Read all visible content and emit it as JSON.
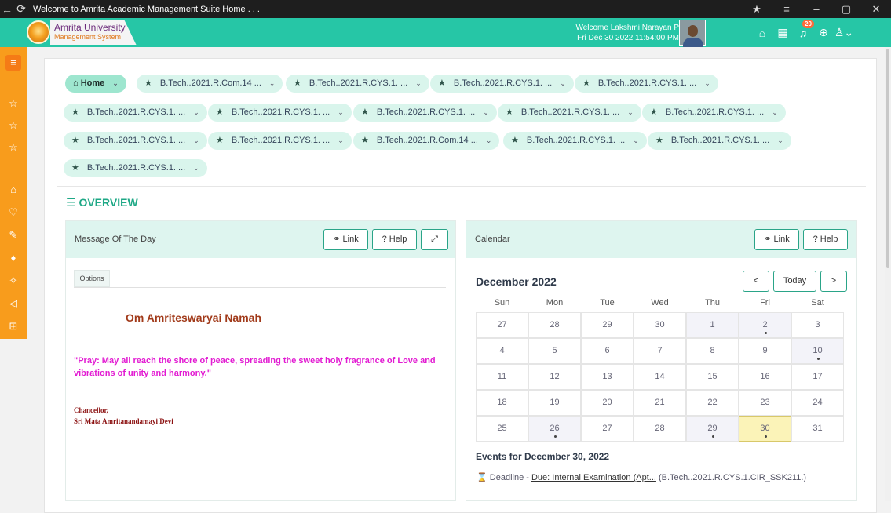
{
  "window": {
    "title": "Welcome to Amrita Academic Management Suite Home . . .",
    "back_icon": "←",
    "refresh_icon": "⟳",
    "pin_icon": "★",
    "menu_icon": "≡",
    "min_icon": "–",
    "max_icon": "▢",
    "close_icon": "✕"
  },
  "header": {
    "brand_line1": "Amrita University",
    "brand_line2": "Management System",
    "welcome": "Welcome Lakshmi Narayan P",
    "datetime": "Fri Dec 30 2022 11:54:00 PM",
    "notification_count": "20",
    "icons": {
      "home": "⌂",
      "grid": "▦",
      "bell": "♫",
      "globe": "⊕",
      "user": "♙⌄"
    }
  },
  "sidebar": {
    "items": [
      "≡",
      "☆",
      "☆",
      "☆",
      "⌂",
      "♡",
      "✎",
      "♦",
      "✧",
      "◁",
      "⊞"
    ]
  },
  "shortcuts": {
    "home_label": "Home",
    "items": [
      "B.Tech..2021.R.Com.14 ...",
      "B.Tech..2021.R.CYS.1. ...",
      "B.Tech..2021.R.CYS.1. ...",
      "B.Tech..2021.R.CYS.1. ...",
      "B.Tech..2021.R.CYS.1. ...",
      "B.Tech..2021.R.CYS.1. ...",
      "B.Tech..2021.R.CYS.1. ...",
      "B.Tech..2021.R.CYS.1. ...",
      "B.Tech..2021.R.CYS.1. ...",
      "B.Tech..2021.R.CYS.1. ...",
      "B.Tech..2021.R.CYS.1. ...",
      "B.Tech..2021.R.Com.14 ...",
      "B.Tech..2021.R.CYS.1. ...",
      "B.Tech..2021.R.CYS.1. ...",
      "B.Tech..2021.R.CYS.1. ..."
    ]
  },
  "overview": {
    "title": "OVERVIEW"
  },
  "motd": {
    "title": "Message Of The Day",
    "link_label": "Link",
    "help_label": "? Help",
    "options_tab": "Options",
    "greeting": "Om Amriteswaryai Namah",
    "quote": "\"Pray: May all reach the shore of peace, spreading the sweet holy fragrance of Love and vibrations of unity and harmony.\"",
    "signature_title": "Chancellor,",
    "signature_name": "Sri Mata Amritanandamayi Devi"
  },
  "calendar": {
    "title": "Calendar",
    "link_label": "Link",
    "help_label": "? Help",
    "month_label": "December 2022",
    "prev_label": "<",
    "today_label": "Today",
    "next_label": ">",
    "weekdays": [
      "Sun",
      "Mon",
      "Tue",
      "Wed",
      "Thu",
      "Fri",
      "Sat"
    ],
    "weeks": [
      [
        "27",
        "28",
        "29",
        "30",
        "1",
        "2",
        "3"
      ],
      [
        "4",
        "5",
        "6",
        "7",
        "8",
        "9",
        "10"
      ],
      [
        "11",
        "12",
        "13",
        "14",
        "15",
        "16",
        "17"
      ],
      [
        "18",
        "19",
        "20",
        "21",
        "22",
        "23",
        "24"
      ],
      [
        "25",
        "26",
        "27",
        "28",
        "29",
        "30",
        "31"
      ]
    ],
    "event_days": [
      "1",
      "2",
      "10",
      "26",
      "29",
      "30"
    ],
    "today": "30",
    "events_heading": "Events for December 30, 2022",
    "event_prefix": "Deadline - ",
    "event_link": "Due: Internal Examination (Apt...",
    "event_suffix": " (B.Tech..2021.R.CYS.1.CIR_SSK211.)"
  }
}
